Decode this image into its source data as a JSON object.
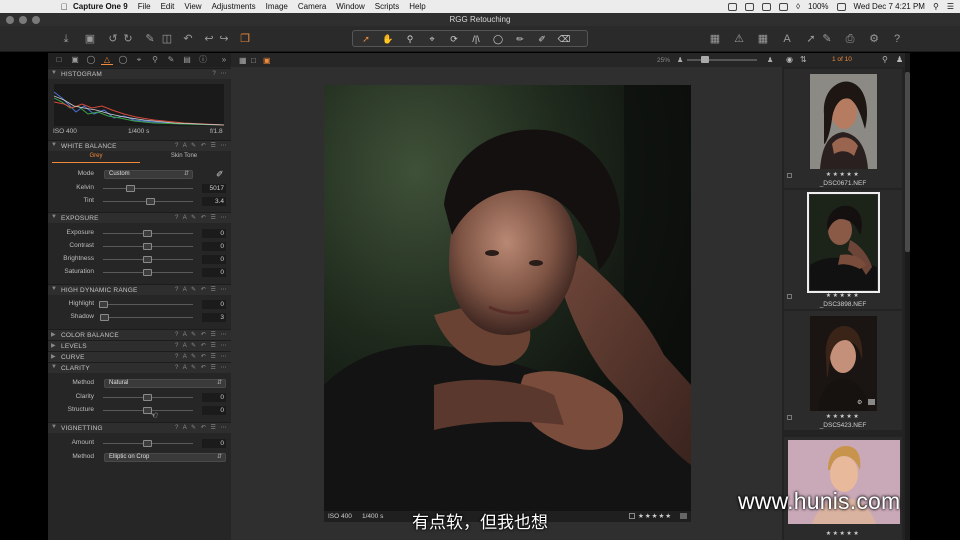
{
  "menubar": {
    "apple_icon": "apple-icon",
    "items": [
      "Capture One 9",
      "File",
      "Edit",
      "View",
      "Adjustments",
      "Image",
      "Camera",
      "Window",
      "Scripts",
      "Help"
    ],
    "battery": "100%",
    "clock": "Wed Dec 7  4:21 PM"
  },
  "window": {
    "title": "RGG Retouching"
  },
  "toolbar": {
    "left_icons": [
      "import-icon",
      "camera-icon",
      "rotate-left-icon",
      "rotate-right-icon",
      "brush-icon",
      "trash-icon",
      "reset-icon",
      "undo-icon",
      "redo-icon",
      "copy-icon"
    ],
    "cursor_tools": [
      "select-icon",
      "pan-icon",
      "zoom-icon",
      "crop-icon",
      "rotate-icon",
      "keystone-icon",
      "spot-icon",
      "brush-draw-icon",
      "picker-icon",
      "eraser-icon"
    ],
    "right_icons": [
      "layout-icon",
      "warning-icon",
      "grid-icon",
      "text-icon",
      "apply-icon",
      "print-icon",
      "settings-icon",
      "help-icon"
    ]
  },
  "tool_tabs": [
    "folder-icon",
    "camera-tab-icon",
    "color-icon",
    "exposure-tab-icon",
    "lens-icon",
    "crop-tab-icon",
    "search-tab-icon",
    "brush-tab-icon",
    "meta-icon",
    "info-icon"
  ],
  "histogram": {
    "title": "HISTOGRAM",
    "iso": "ISO 400",
    "shutter": "1/400 s",
    "aperture": "f/1.8"
  },
  "white_balance": {
    "title": "WHITE BALANCE",
    "tabs": [
      "Grey",
      "Skin Tone"
    ],
    "mode_label": "Mode",
    "mode_value": "Custom",
    "kelvin_label": "Kelvin",
    "kelvin_value": "5017",
    "tint_label": "Tint",
    "tint_value": "3.4"
  },
  "exposure": {
    "title": "EXPOSURE",
    "rows": [
      {
        "label": "Exposure",
        "value": "0"
      },
      {
        "label": "Contrast",
        "value": "0"
      },
      {
        "label": "Brightness",
        "value": "0"
      },
      {
        "label": "Saturation",
        "value": "0"
      }
    ]
  },
  "hdr": {
    "title": "HIGH DYNAMIC RANGE",
    "rows": [
      {
        "label": "Highlight",
        "value": "0"
      },
      {
        "label": "Shadow",
        "value": "3"
      }
    ]
  },
  "collapsed_sections": [
    "COLOR BALANCE",
    "LEVELS",
    "CURVE"
  ],
  "clarity": {
    "title": "CLARITY",
    "method_label": "Method",
    "method_value": "Natural",
    "rows": [
      {
        "label": "Clarity",
        "value": "0"
      },
      {
        "label": "Structure",
        "value": "0"
      }
    ]
  },
  "vignetting": {
    "title": "VIGNETTING",
    "amount_label": "Amount",
    "amount_value": "0",
    "method_label": "Method",
    "method_value": "Elliptic on Crop"
  },
  "viewer": {
    "zoom": "25%",
    "counter": "1 of 10",
    "meta_iso": "ISO 400",
    "meta_shutter": "1/400 s",
    "stars": "★★★★★"
  },
  "filmstrip": [
    {
      "name": "_DSC0671.NEF",
      "stars": "★★★★★",
      "selected": false
    },
    {
      "name": "_DSC3898.NEF",
      "stars": "★★★★★",
      "selected": true
    },
    {
      "name": "_DSC5423.NEF",
      "stars": "★★★★★",
      "selected": false
    },
    {
      "name": "",
      "stars": "★★★★★",
      "selected": false
    }
  ],
  "overlay": {
    "subtitle": "有点软，但我也想",
    "watermark": "www.hunis.com"
  },
  "colors": {
    "accent": "#f08a3c",
    "panel": "#262626",
    "viewer": "#2f2f2f"
  }
}
